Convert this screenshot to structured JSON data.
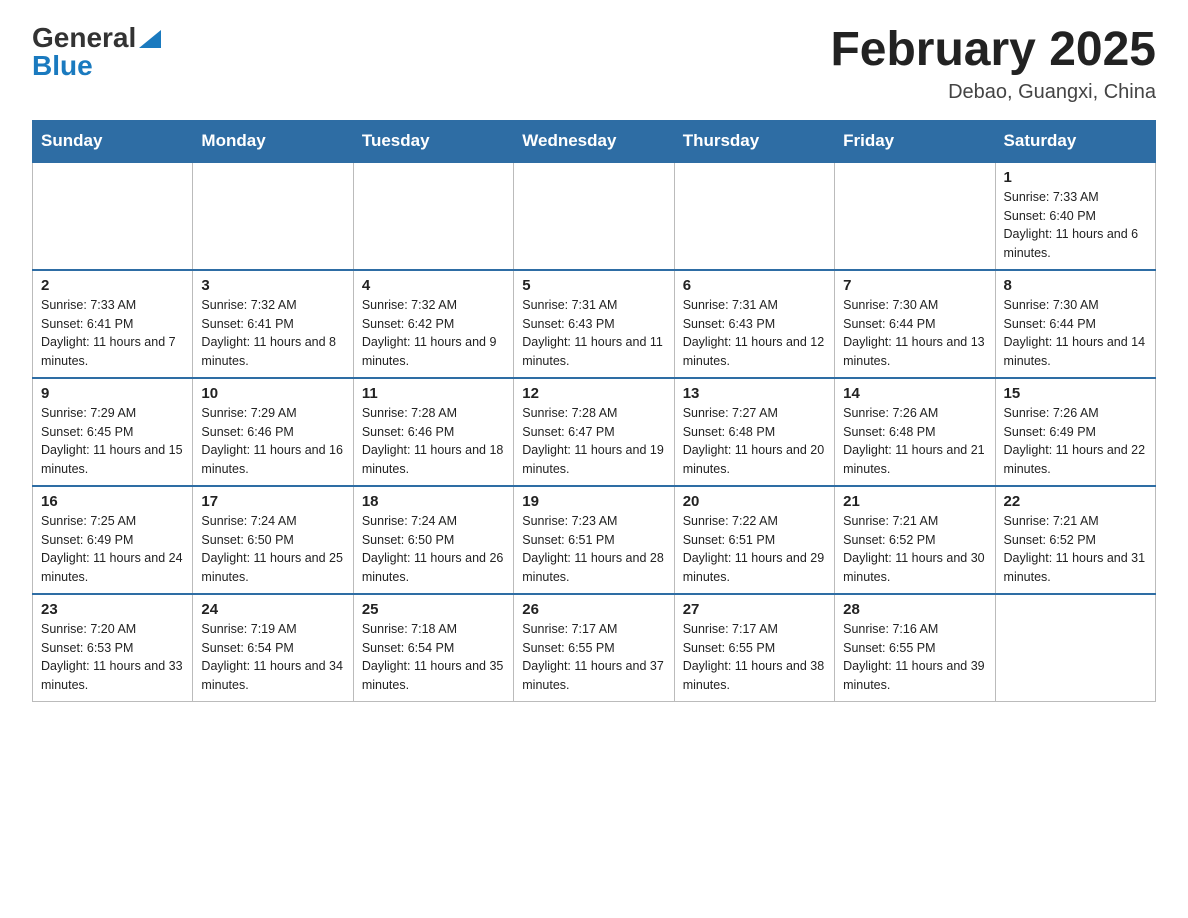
{
  "logo": {
    "general": "General",
    "blue": "Blue"
  },
  "title": "February 2025",
  "location": "Debao, Guangxi, China",
  "days_of_week": [
    "Sunday",
    "Monday",
    "Tuesday",
    "Wednesday",
    "Thursday",
    "Friday",
    "Saturday"
  ],
  "weeks": [
    [
      {
        "day": "",
        "info": ""
      },
      {
        "day": "",
        "info": ""
      },
      {
        "day": "",
        "info": ""
      },
      {
        "day": "",
        "info": ""
      },
      {
        "day": "",
        "info": ""
      },
      {
        "day": "",
        "info": ""
      },
      {
        "day": "1",
        "info": "Sunrise: 7:33 AM\nSunset: 6:40 PM\nDaylight: 11 hours and 6 minutes."
      }
    ],
    [
      {
        "day": "2",
        "info": "Sunrise: 7:33 AM\nSunset: 6:41 PM\nDaylight: 11 hours and 7 minutes."
      },
      {
        "day": "3",
        "info": "Sunrise: 7:32 AM\nSunset: 6:41 PM\nDaylight: 11 hours and 8 minutes."
      },
      {
        "day": "4",
        "info": "Sunrise: 7:32 AM\nSunset: 6:42 PM\nDaylight: 11 hours and 9 minutes."
      },
      {
        "day": "5",
        "info": "Sunrise: 7:31 AM\nSunset: 6:43 PM\nDaylight: 11 hours and 11 minutes."
      },
      {
        "day": "6",
        "info": "Sunrise: 7:31 AM\nSunset: 6:43 PM\nDaylight: 11 hours and 12 minutes."
      },
      {
        "day": "7",
        "info": "Sunrise: 7:30 AM\nSunset: 6:44 PM\nDaylight: 11 hours and 13 minutes."
      },
      {
        "day": "8",
        "info": "Sunrise: 7:30 AM\nSunset: 6:44 PM\nDaylight: 11 hours and 14 minutes."
      }
    ],
    [
      {
        "day": "9",
        "info": "Sunrise: 7:29 AM\nSunset: 6:45 PM\nDaylight: 11 hours and 15 minutes."
      },
      {
        "day": "10",
        "info": "Sunrise: 7:29 AM\nSunset: 6:46 PM\nDaylight: 11 hours and 16 minutes."
      },
      {
        "day": "11",
        "info": "Sunrise: 7:28 AM\nSunset: 6:46 PM\nDaylight: 11 hours and 18 minutes."
      },
      {
        "day": "12",
        "info": "Sunrise: 7:28 AM\nSunset: 6:47 PM\nDaylight: 11 hours and 19 minutes."
      },
      {
        "day": "13",
        "info": "Sunrise: 7:27 AM\nSunset: 6:48 PM\nDaylight: 11 hours and 20 minutes."
      },
      {
        "day": "14",
        "info": "Sunrise: 7:26 AM\nSunset: 6:48 PM\nDaylight: 11 hours and 21 minutes."
      },
      {
        "day": "15",
        "info": "Sunrise: 7:26 AM\nSunset: 6:49 PM\nDaylight: 11 hours and 22 minutes."
      }
    ],
    [
      {
        "day": "16",
        "info": "Sunrise: 7:25 AM\nSunset: 6:49 PM\nDaylight: 11 hours and 24 minutes."
      },
      {
        "day": "17",
        "info": "Sunrise: 7:24 AM\nSunset: 6:50 PM\nDaylight: 11 hours and 25 minutes."
      },
      {
        "day": "18",
        "info": "Sunrise: 7:24 AM\nSunset: 6:50 PM\nDaylight: 11 hours and 26 minutes."
      },
      {
        "day": "19",
        "info": "Sunrise: 7:23 AM\nSunset: 6:51 PM\nDaylight: 11 hours and 28 minutes."
      },
      {
        "day": "20",
        "info": "Sunrise: 7:22 AM\nSunset: 6:51 PM\nDaylight: 11 hours and 29 minutes."
      },
      {
        "day": "21",
        "info": "Sunrise: 7:21 AM\nSunset: 6:52 PM\nDaylight: 11 hours and 30 minutes."
      },
      {
        "day": "22",
        "info": "Sunrise: 7:21 AM\nSunset: 6:52 PM\nDaylight: 11 hours and 31 minutes."
      }
    ],
    [
      {
        "day": "23",
        "info": "Sunrise: 7:20 AM\nSunset: 6:53 PM\nDaylight: 11 hours and 33 minutes."
      },
      {
        "day": "24",
        "info": "Sunrise: 7:19 AM\nSunset: 6:54 PM\nDaylight: 11 hours and 34 minutes."
      },
      {
        "day": "25",
        "info": "Sunrise: 7:18 AM\nSunset: 6:54 PM\nDaylight: 11 hours and 35 minutes."
      },
      {
        "day": "26",
        "info": "Sunrise: 7:17 AM\nSunset: 6:55 PM\nDaylight: 11 hours and 37 minutes."
      },
      {
        "day": "27",
        "info": "Sunrise: 7:17 AM\nSunset: 6:55 PM\nDaylight: 11 hours and 38 minutes."
      },
      {
        "day": "28",
        "info": "Sunrise: 7:16 AM\nSunset: 6:55 PM\nDaylight: 11 hours and 39 minutes."
      },
      {
        "day": "",
        "info": ""
      }
    ]
  ]
}
